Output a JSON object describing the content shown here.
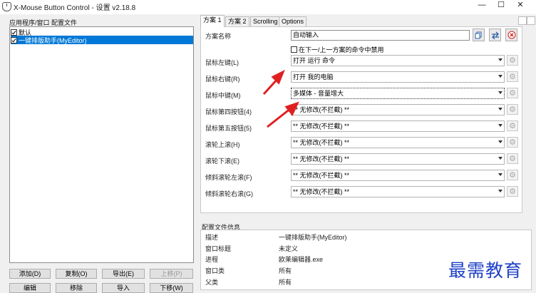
{
  "window": {
    "title": "X-Mouse Button Control - 设置 v2.18.8",
    "minimize": "—",
    "maximize": "☐",
    "close": "✕"
  },
  "left": {
    "label": "应用程序/窗口 配置文件",
    "items": [
      {
        "label": "默认",
        "checked": true,
        "selected": false
      },
      {
        "label": "一键排版助手(MyEditor)",
        "checked": true,
        "selected": true
      }
    ],
    "buttons": {
      "add": "添加(D)",
      "copy": "复制(O)",
      "export": "导出(E)",
      "moveup": "上移(P)",
      "edit": "编辑",
      "remove": "移除",
      "import": "导入",
      "movedown": "下移(W)"
    }
  },
  "tabs": [
    "方案 1",
    "方案 2",
    "Scrolling",
    "Options"
  ],
  "profile": {
    "name_label": "方案名称",
    "name_value": "自动输入",
    "disable_label": "在下一/上一方案的命令中禁用"
  },
  "rows": [
    {
      "label": "鼠标左键(L)",
      "value": "打开 运行 命令"
    },
    {
      "label": "鼠标右键(R)",
      "value": "打开 我的电脑"
    },
    {
      "label": "鼠标中键(M)",
      "value": "多媒体 - 音量增大"
    },
    {
      "label": "鼠标第四按钮(4)",
      "value": "** 无修改(不拦截) **"
    },
    {
      "label": "鼠标第五按钮(5)",
      "value": "** 无修改(不拦截) **"
    },
    {
      "label": "滚轮上滚(H)",
      "value": "** 无修改(不拦截) **"
    },
    {
      "label": "滚轮下滚(E)",
      "value": "** 无修改(不拦截) **"
    },
    {
      "label": "倾斜滚轮左滚(F)",
      "value": "** 无修改(不拦截) **"
    },
    {
      "label": "倾斜滚轮右滚(G)",
      "value": "** 无修改(不拦截) **"
    }
  ],
  "info": {
    "title": "配置文件信息",
    "rows": [
      {
        "key": "描述",
        "value": "一键排版助手(MyEditor)"
      },
      {
        "key": "窗口标题",
        "value": "未定义"
      },
      {
        "key": "进程",
        "value": "欧莱编辑器.exe"
      },
      {
        "key": "窗口类",
        "value": "所有"
      },
      {
        "key": "父类",
        "value": "所有"
      }
    ]
  },
  "watermark": "最需教育",
  "colors": {
    "accent": "#0078d7",
    "arrow": "#e02020",
    "watermark": "#1e40c8"
  }
}
